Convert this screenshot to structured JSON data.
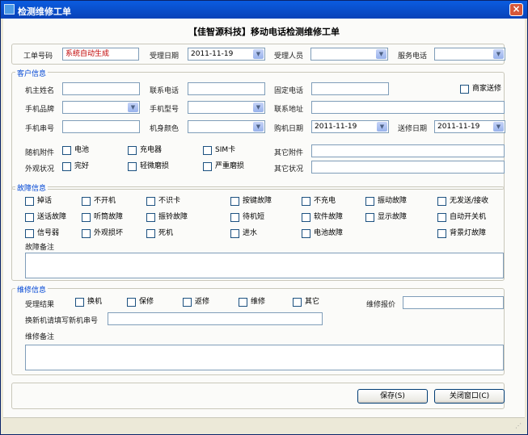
{
  "window": {
    "title": "检测维修工单",
    "close_glyph": "×"
  },
  "form_title": "【佳智源科技】移动电话检测维修工单",
  "header": {
    "order_no_label": "工单号码",
    "order_no_value": "系统自动生成",
    "accept_date_label": "受理日期",
    "accept_date_value": "2011-11-19",
    "accept_staff_label": "受理人员",
    "accept_staff_value": "",
    "service_phone_label": "服务电话",
    "service_phone_value": ""
  },
  "customer": {
    "title": "客户信息",
    "owner_name_label": "机主姓名",
    "contact_phone_label": "联系电话",
    "landline_label": "固定电话",
    "dealer_label": "商家送修",
    "brand_label": "手机品牌",
    "model_label": "手机型号",
    "address_label": "联系地址",
    "serial_label": "手机串号",
    "color_label": "机身颜色",
    "purchase_date_label": "购机日期",
    "purchase_date_value": "2011-11-19",
    "repair_date_label": "送修日期",
    "repair_date_value": "2011-11-19",
    "accessories_label": "随机附件",
    "accessories": [
      "电池",
      "充电器",
      "SIM卡"
    ],
    "other_accessories_label": "其它附件",
    "appearance_label": "外观状况",
    "appearance": [
      "完好",
      "轻微磨损",
      "严重磨损"
    ],
    "other_status_label": "其它状况"
  },
  "fault": {
    "title": "故障信息",
    "row1": [
      "掉话",
      "不开机",
      "不识卡",
      "按键故障",
      "不充电",
      "振动故障",
      "无发送/接收"
    ],
    "row2": [
      "送话故障",
      "听筒故障",
      "振铃故障",
      "待机短",
      "软件故障",
      "显示故障",
      "自动开关机"
    ],
    "row3": [
      "信号弱",
      "外观损坏",
      "死机",
      "进水",
      "电池故障",
      "背景灯故障"
    ],
    "remark_label": "故障备注"
  },
  "repair": {
    "title": "维修信息",
    "result_label": "受理结果",
    "results": [
      "换机",
      "保修",
      "返修",
      "维修",
      "其它"
    ],
    "quote_label": "维修报价",
    "new_serial_label": "换新机请填写新机串号",
    "remark_label": "维修备注"
  },
  "buttons": {
    "save": "保存(S)",
    "close": "关闭窗口(C)"
  },
  "icons": {
    "dropdown": "▼",
    "grip": "⋰"
  }
}
